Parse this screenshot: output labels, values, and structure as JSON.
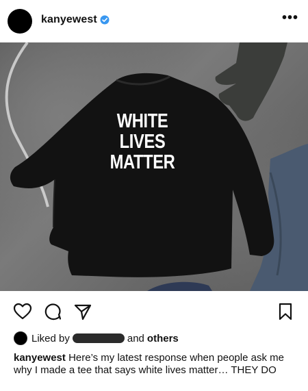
{
  "header": {
    "username": "kanyewest",
    "verified_icon": "verified-badge-icon",
    "more_label": "•••"
  },
  "photo": {
    "shirt_text": [
      "WHITE",
      "LIVES",
      "MATTER"
    ]
  },
  "actions": {
    "like_icon": "heart-icon",
    "comment_icon": "comment-icon",
    "share_icon": "send-icon",
    "save_icon": "bookmark-icon"
  },
  "likes": {
    "prefix": "Liked by",
    "suffix_and": "and",
    "suffix_others": "others"
  },
  "caption": {
    "username": "kanyewest",
    "text": "Here’s my latest response when people ask me why I made a tee that says white lives matter… THEY DO"
  },
  "colors": {
    "accent_verified": "#3897f0",
    "text": "#111111"
  }
}
